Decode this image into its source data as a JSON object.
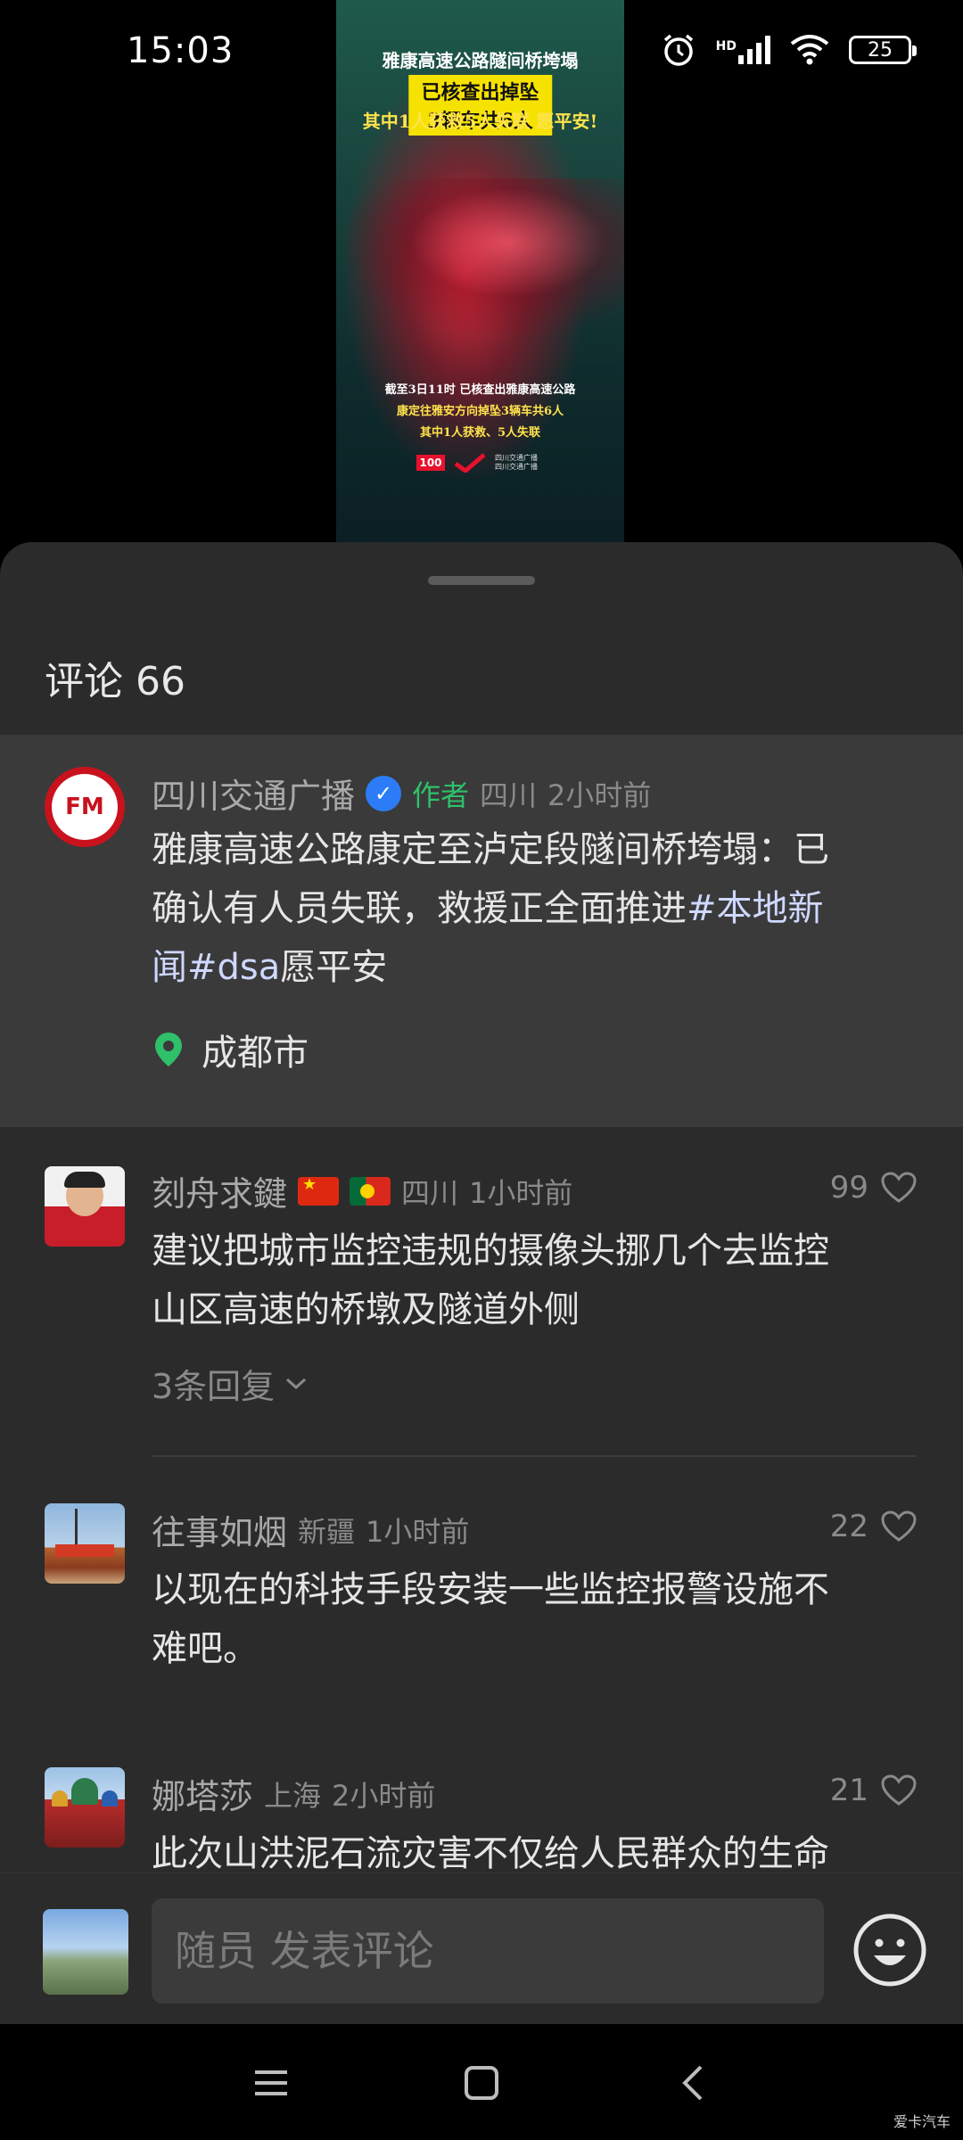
{
  "status_bar": {
    "time": "15:03",
    "network": "HD",
    "battery": "25"
  },
  "video": {
    "headline_line1": "雅康高速公路隧间桥垮塌",
    "headline_line2": "已核查出掉坠3辆车共6人",
    "headline_line3": "其中1人获救5人失联 愿平安!",
    "caption_line1": "截至3日11时 已核查出雅康高速公路",
    "caption_line2": "康定往雅安方向掉坠3辆车共6人",
    "caption_line3": "其中1人获救、5人失联",
    "logo_mark": "100",
    "logo_text_line1": "四川交通广播",
    "logo_text_line2": "四川交通广播"
  },
  "comments_sheet": {
    "title": "评论 66",
    "pinned": {
      "user": "四川交通广播",
      "author_tag": "作者",
      "region": "四川",
      "time": "2小时前",
      "text_line1": "雅康高速公路康定至泸定段隧间桥垮塌：已",
      "text_line2_plain": "确认有人员失联，救援正全面推进",
      "text_line2_tag": "#本地新",
      "text_line3_tag": "闻#dsa",
      "text_line3_plain": "愿平安",
      "location": "成都市",
      "avatar_text": "FM"
    },
    "comments": [
      {
        "user": "刻舟求鍵",
        "region": "四川",
        "time": "1小时前",
        "likes": "99",
        "text_line1": "建议把城市监控违规的摄像头挪几个去监控",
        "text_line2": "山区高速的桥墩及隧道外侧",
        "replies": "3条回复"
      },
      {
        "user": "往事如烟",
        "region": "新疆",
        "time": "1小时前",
        "likes": "22",
        "text_line1": "以现在的科技手段安装一些监控报警设施不",
        "text_line2": "难吧。"
      },
      {
        "user": "娜塔莎",
        "region": "上海",
        "time": "2小时前",
        "likes": "21",
        "text_line1": "此次山洪泥石流灾害不仅给人民群众的生命"
      }
    ]
  },
  "input_bar": {
    "placeholder": "随员 发表评论"
  },
  "watermark": "爱卡汽车",
  "colors": {
    "sheet_bg": "#2b2b2b",
    "pinned_bg": "#3a3a3a",
    "author_green": "#2fc06a",
    "verified_blue": "#2b7cf6",
    "location_green": "#2fc06a"
  }
}
